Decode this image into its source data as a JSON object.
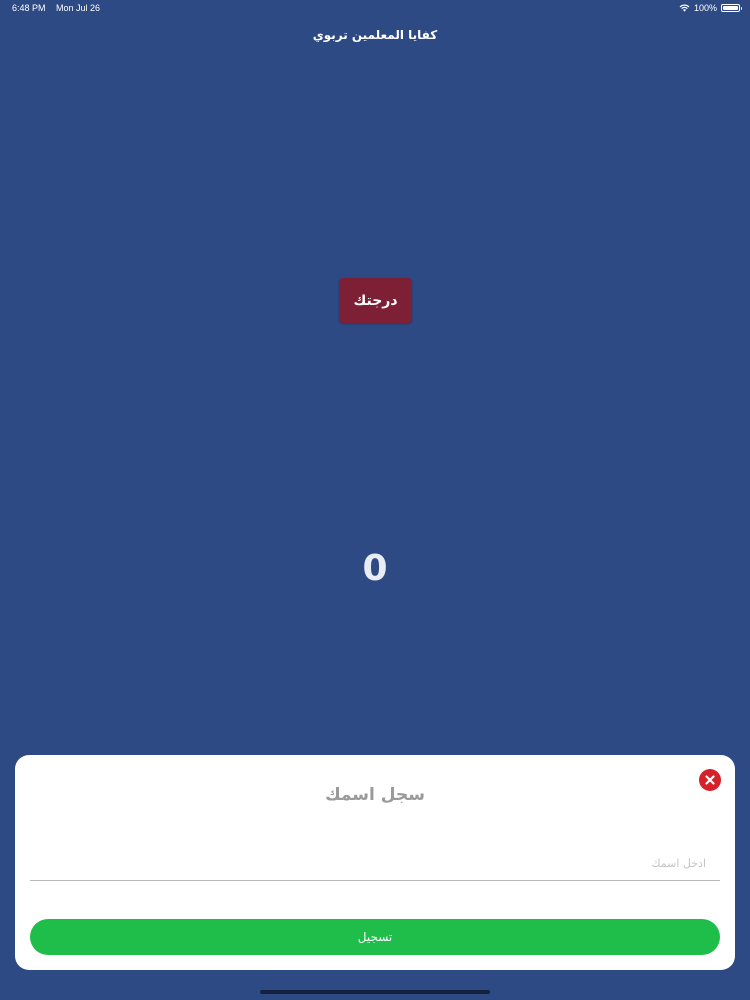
{
  "status_bar": {
    "time": "6:48 PM",
    "date": "Mon Jul 26",
    "battery": "100%",
    "icons": [
      "wifi-icon",
      "battery-icon"
    ]
  },
  "app": {
    "title": "كفايا المعلمين تربوي"
  },
  "score": {
    "label": "درجتك",
    "value": "0",
    "label_color": "#7e2035"
  },
  "modal": {
    "title": "سجل اسمك",
    "input_placeholder": "ادخل اسمك",
    "input_value": "",
    "register_label": "تسجيل",
    "register_color": "#1fbd4a",
    "close_icon": "close-circle-icon",
    "close_color": "#d6202a"
  },
  "colors": {
    "background": "#2e4a85"
  }
}
